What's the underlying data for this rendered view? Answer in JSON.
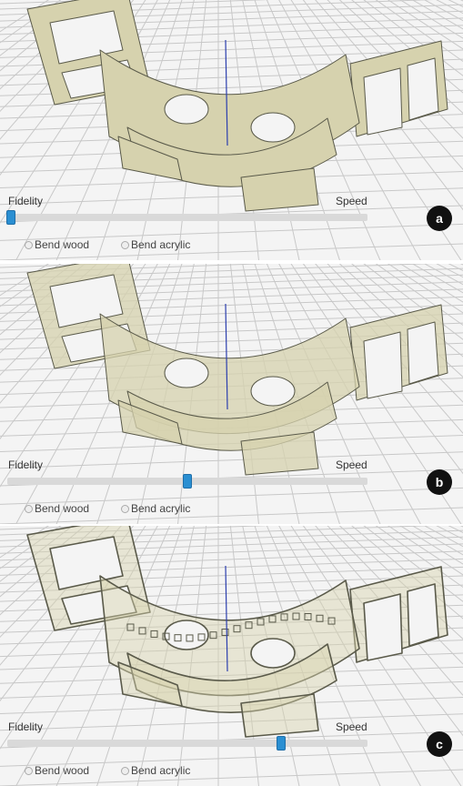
{
  "panels": [
    {
      "badge": "a",
      "fidelity_label": "Fidelity",
      "speed_label": "Speed",
      "slider_position": 0.01,
      "options": [
        "Bend wood",
        "Bend acrylic"
      ],
      "render_style": "solid"
    },
    {
      "badge": "b",
      "fidelity_label": "Fidelity",
      "speed_label": "Speed",
      "slider_position": 0.5,
      "options": [
        "Bend wood",
        "Bend acrylic"
      ],
      "render_style": "semi-transparent"
    },
    {
      "badge": "c",
      "fidelity_label": "Fidelity",
      "speed_label": "Speed",
      "slider_position": 0.76,
      "options": [
        "Bend wood",
        "Bend acrylic"
      ],
      "render_style": "wireframe"
    }
  ],
  "colors": {
    "background": "#f4f4f4",
    "grid_line": "#c8c8c8",
    "model_fill": "#d6d2ae",
    "model_edge": "#5a5a4a",
    "slider_thumb": "#2a8fd2",
    "slider_track": "#d9d9d9",
    "badge": "#111111",
    "axis_line": "#2c3fae"
  }
}
